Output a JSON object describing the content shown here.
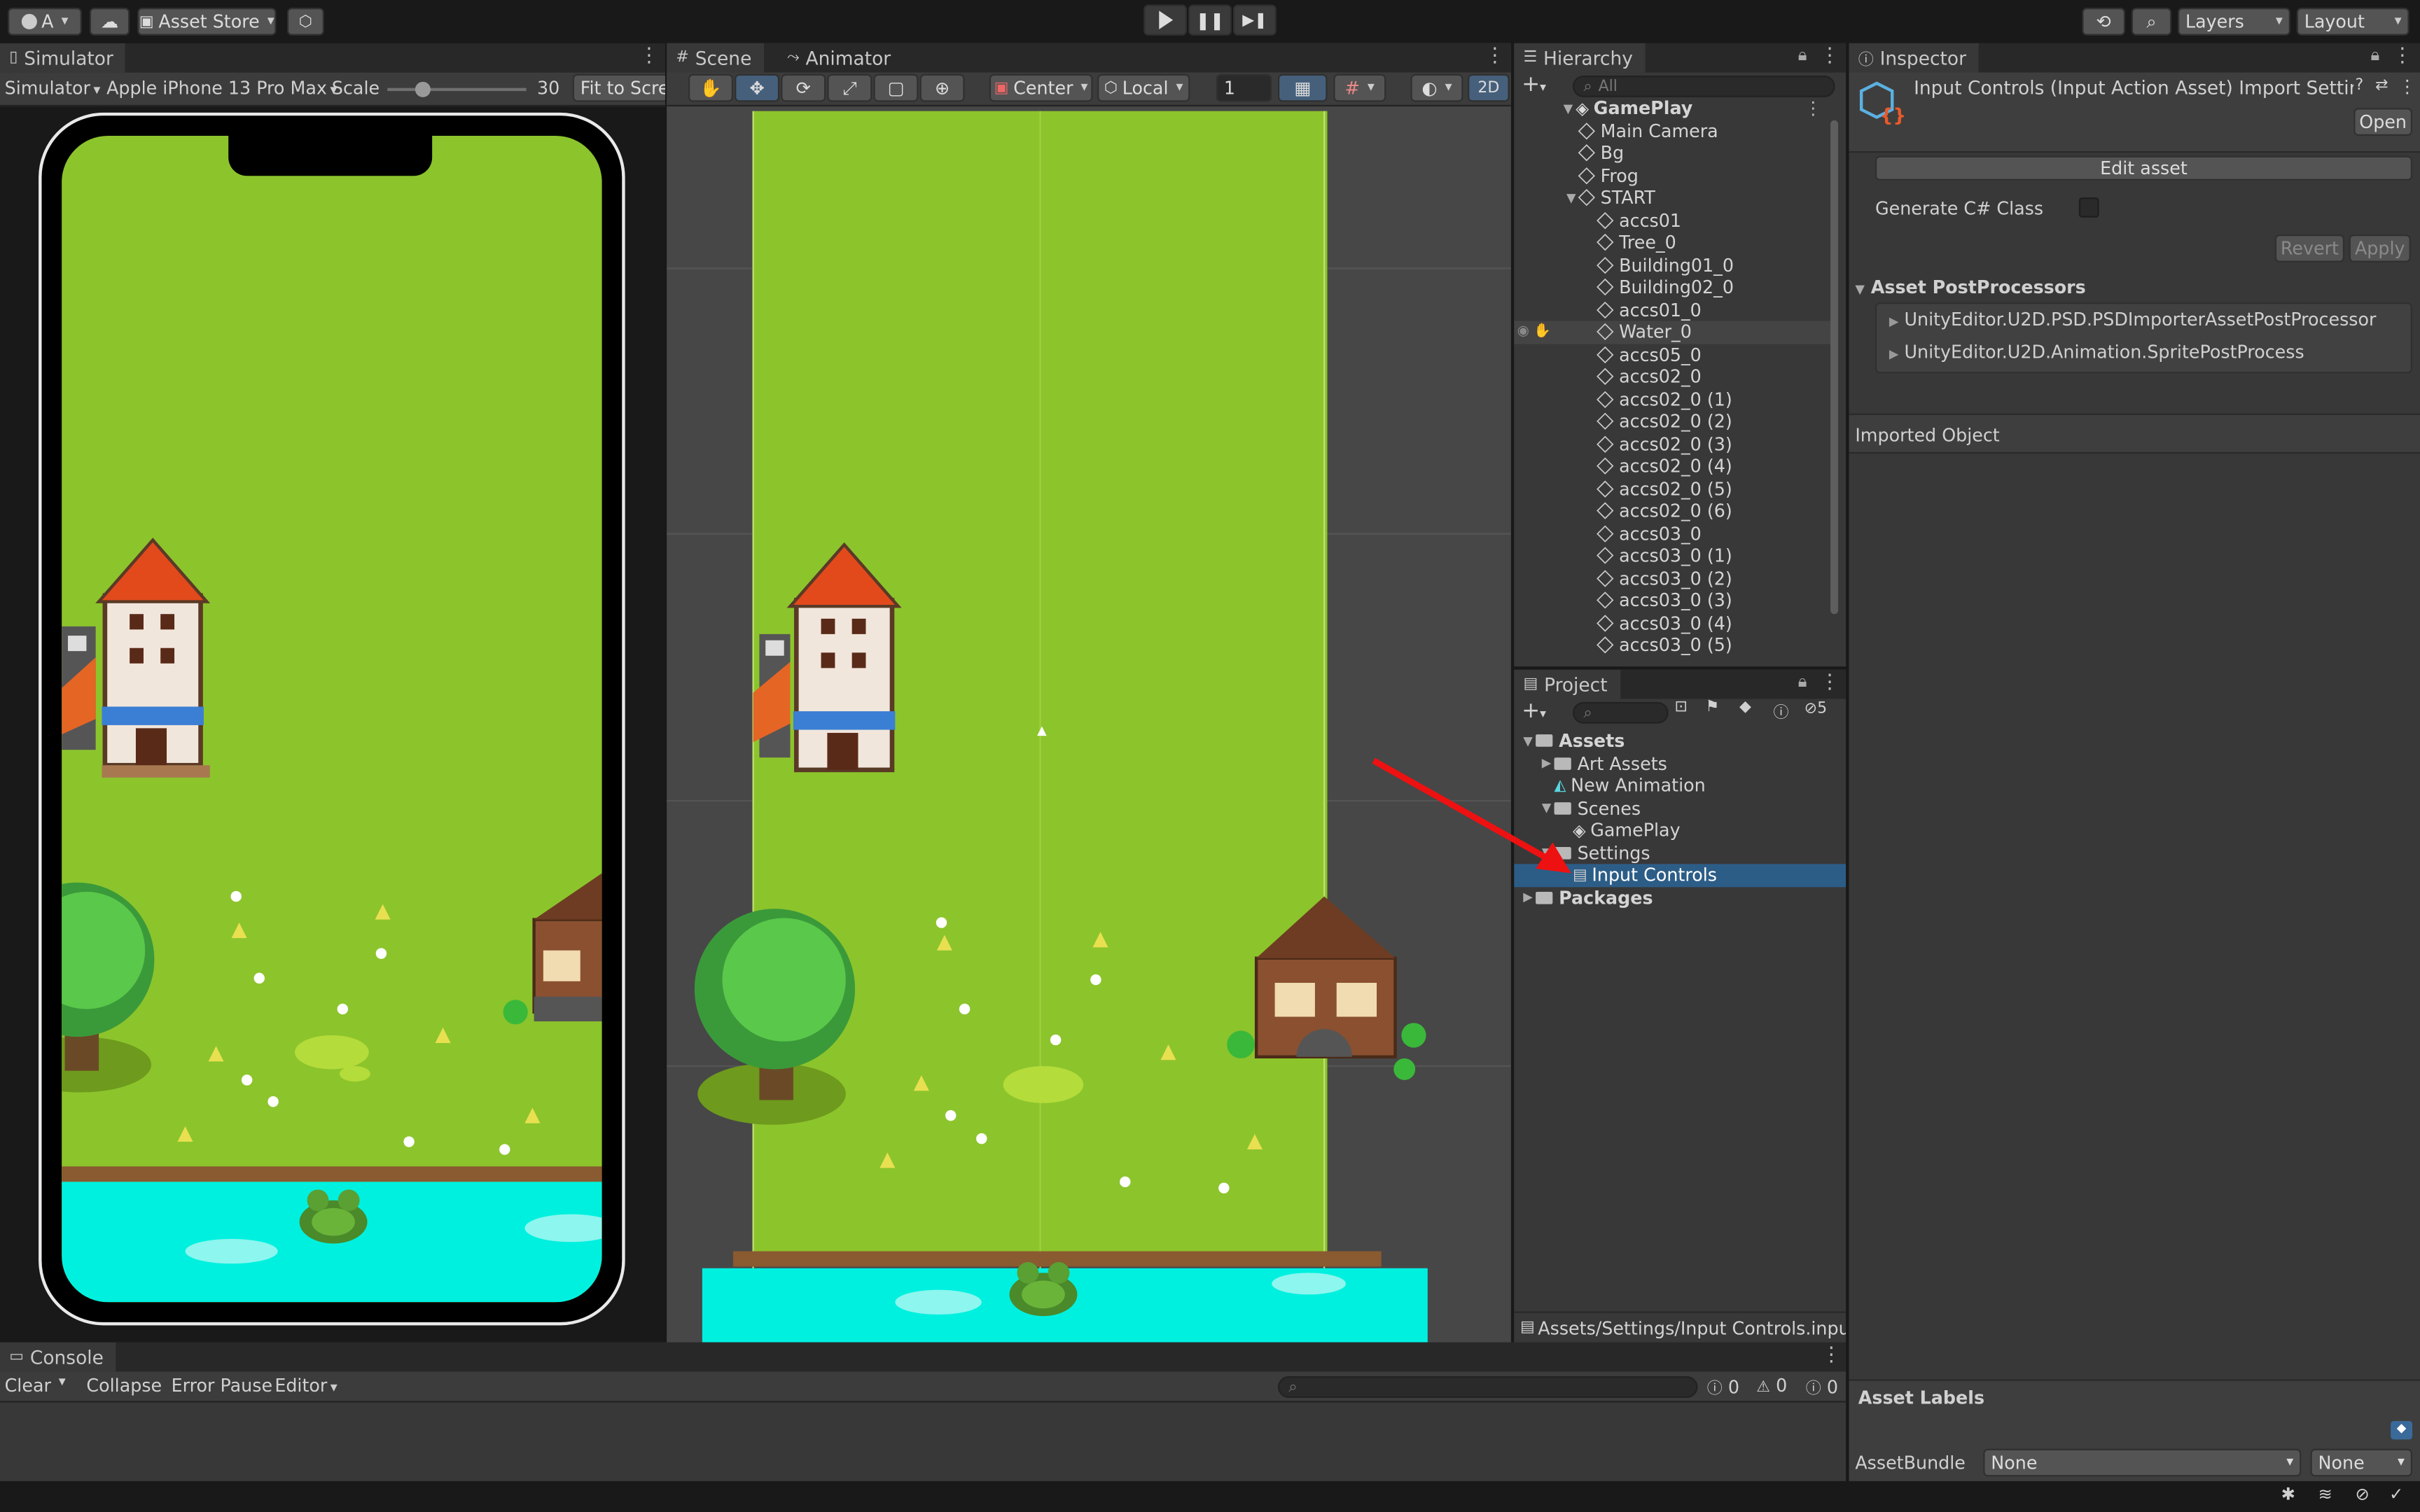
{
  "top_bar": {
    "account": "A",
    "asset_store": "Asset Store",
    "layers": "Layers",
    "layout": "Layout"
  },
  "simulator": {
    "tab": "Simulator",
    "mode": "Simulator",
    "device": "Apple iPhone 13 Pro Max",
    "scale_label": "Scale",
    "scale_value": "30",
    "fit_button": "Fit to Scre"
  },
  "scene": {
    "tab_scene": "Scene",
    "tab_animator": "Animator",
    "pivot": "Center",
    "space": "Local",
    "snap_value": "1",
    "mode_2d": "2D"
  },
  "hierarchy": {
    "tab": "Hierarchy",
    "search_placeholder": "All",
    "root": "GamePlay",
    "items": [
      {
        "name": "Main Camera",
        "indent": 1
      },
      {
        "name": "Bg",
        "indent": 1
      },
      {
        "name": "Frog",
        "indent": 1
      },
      {
        "name": "START",
        "indent": 1,
        "expanded": true
      },
      {
        "name": "accs01",
        "indent": 2
      },
      {
        "name": "Tree_0",
        "indent": 2
      },
      {
        "name": "Building01_0",
        "indent": 2
      },
      {
        "name": "Building02_0",
        "indent": 2
      },
      {
        "name": "accs01_0",
        "indent": 2
      },
      {
        "name": "Water_0",
        "indent": 2,
        "hovered": true
      },
      {
        "name": "accs05_0",
        "indent": 2
      },
      {
        "name": "accs02_0",
        "indent": 2
      },
      {
        "name": "accs02_0 (1)",
        "indent": 2
      },
      {
        "name": "accs02_0 (2)",
        "indent": 2
      },
      {
        "name": "accs02_0 (3)",
        "indent": 2
      },
      {
        "name": "accs02_0 (4)",
        "indent": 2
      },
      {
        "name": "accs02_0 (5)",
        "indent": 2
      },
      {
        "name": "accs02_0 (6)",
        "indent": 2
      },
      {
        "name": "accs03_0",
        "indent": 2
      },
      {
        "name": "accs03_0 (1)",
        "indent": 2
      },
      {
        "name": "accs03_0 (2)",
        "indent": 2
      },
      {
        "name": "accs03_0 (3)",
        "indent": 2
      },
      {
        "name": "accs03_0 (4)",
        "indent": 2
      },
      {
        "name": "accs03_0 (5)",
        "indent": 2
      }
    ]
  },
  "project": {
    "tab": "Project",
    "hidden_count": "5",
    "tree": [
      {
        "name": "Assets",
        "indent": 0,
        "bold": true,
        "expanded": true,
        "icon": "folder-open-icon"
      },
      {
        "name": "Art Assets",
        "indent": 1,
        "collapsed": true,
        "icon": "folder-icon"
      },
      {
        "name": "New Animation",
        "indent": 1,
        "icon": "animation-clip-icon"
      },
      {
        "name": "Scenes",
        "indent": 1,
        "expanded": true,
        "icon": "folder-open-icon"
      },
      {
        "name": "GamePlay",
        "indent": 2,
        "icon": "unity-scene-icon"
      },
      {
        "name": "Settings",
        "indent": 1,
        "expanded": true,
        "icon": "folder-open-icon"
      },
      {
        "name": "Input Controls",
        "indent": 2,
        "selected": true,
        "icon": "input-actions-icon"
      },
      {
        "name": "Packages",
        "indent": 0,
        "bold": true,
        "collapsed": true,
        "icon": "folder-icon"
      }
    ],
    "path": "Assets/Settings/Input Controls.inputa"
  },
  "inspector": {
    "tab": "Inspector",
    "title": "Input Controls (Input Action Asset) Import Settings",
    "open_button": "Open",
    "edit_asset": "Edit asset",
    "generate_label": "Generate C# Class",
    "revert": "Revert",
    "apply": "Apply",
    "postprocessors_header": "Asset PostProcessors",
    "postprocessors": [
      "UnityEditor.U2D.PSD.PSDImporterAssetPostProcessor",
      "UnityEditor.U2D.Animation.SpritePostProcess"
    ],
    "imported_object": "Imported Object",
    "asset_labels": "Asset Labels",
    "asset_bundle_label": "AssetBundle",
    "asset_bundle_value": "None",
    "asset_bundle_variant": "None"
  },
  "console": {
    "tab": "Console",
    "clear": "Clear",
    "collapse": "Collapse",
    "error_pause": "Error Pause",
    "editor": "Editor",
    "log_count": "0",
    "warn_count": "0",
    "error_count": "0"
  },
  "colors": {
    "grass": "#8cc42c",
    "water": "#00f0e0",
    "selection": "#2c5d87",
    "arrow": "#ee1111"
  }
}
